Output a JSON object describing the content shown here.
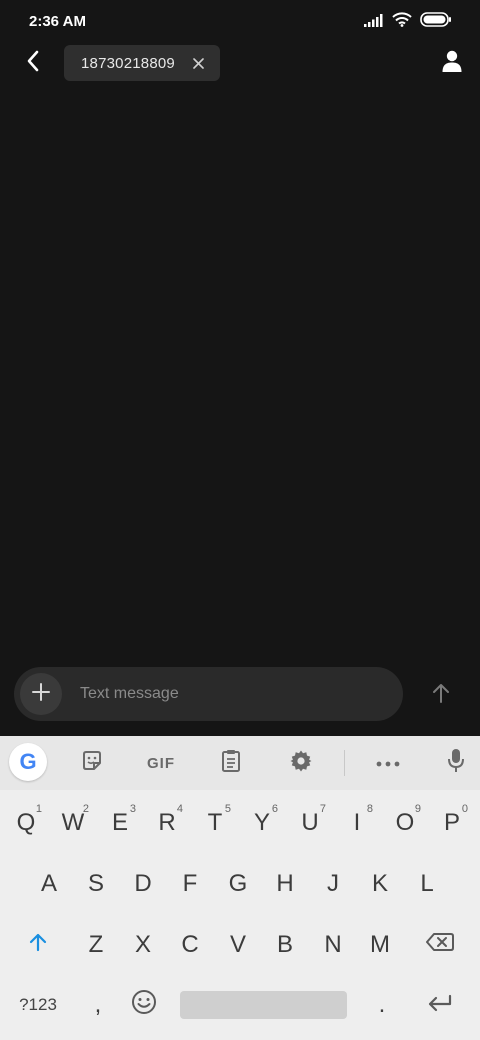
{
  "status_bar": {
    "time": "2:36 AM",
    "icons": [
      "signal-icon",
      "wifi-icon",
      "battery-icon"
    ]
  },
  "header": {
    "recipient_chip": "18730218809",
    "icons": [
      "back-arrow-icon",
      "chip-close-icon",
      "contact-person-icon"
    ]
  },
  "composer": {
    "placeholder": "Text message",
    "value": "",
    "icons": [
      "plus-icon",
      "send-arrow-icon"
    ]
  },
  "keyboard": {
    "toolbar": {
      "google_label": "G",
      "gif_label": "GIF",
      "icons": [
        "google-icon",
        "sticker-icon",
        "clipboard-icon",
        "settings-gear-icon",
        "more-dots-icon",
        "microphone-icon"
      ]
    },
    "row1": [
      {
        "letter": "Q",
        "hint": "1"
      },
      {
        "letter": "W",
        "hint": "2"
      },
      {
        "letter": "E",
        "hint": "3"
      },
      {
        "letter": "R",
        "hint": "4"
      },
      {
        "letter": "T",
        "hint": "5"
      },
      {
        "letter": "Y",
        "hint": "6"
      },
      {
        "letter": "U",
        "hint": "7"
      },
      {
        "letter": "I",
        "hint": "8"
      },
      {
        "letter": "O",
        "hint": "9"
      },
      {
        "letter": "P",
        "hint": "0"
      }
    ],
    "row2": [
      "A",
      "S",
      "D",
      "F",
      "G",
      "H",
      "J",
      "K",
      "L"
    ],
    "row3": [
      "Z",
      "X",
      "C",
      "V",
      "B",
      "N",
      "M"
    ],
    "symbols_key": "?123",
    "comma_key": ",",
    "period_key": ".",
    "accent_color": "#1a8fe0"
  }
}
